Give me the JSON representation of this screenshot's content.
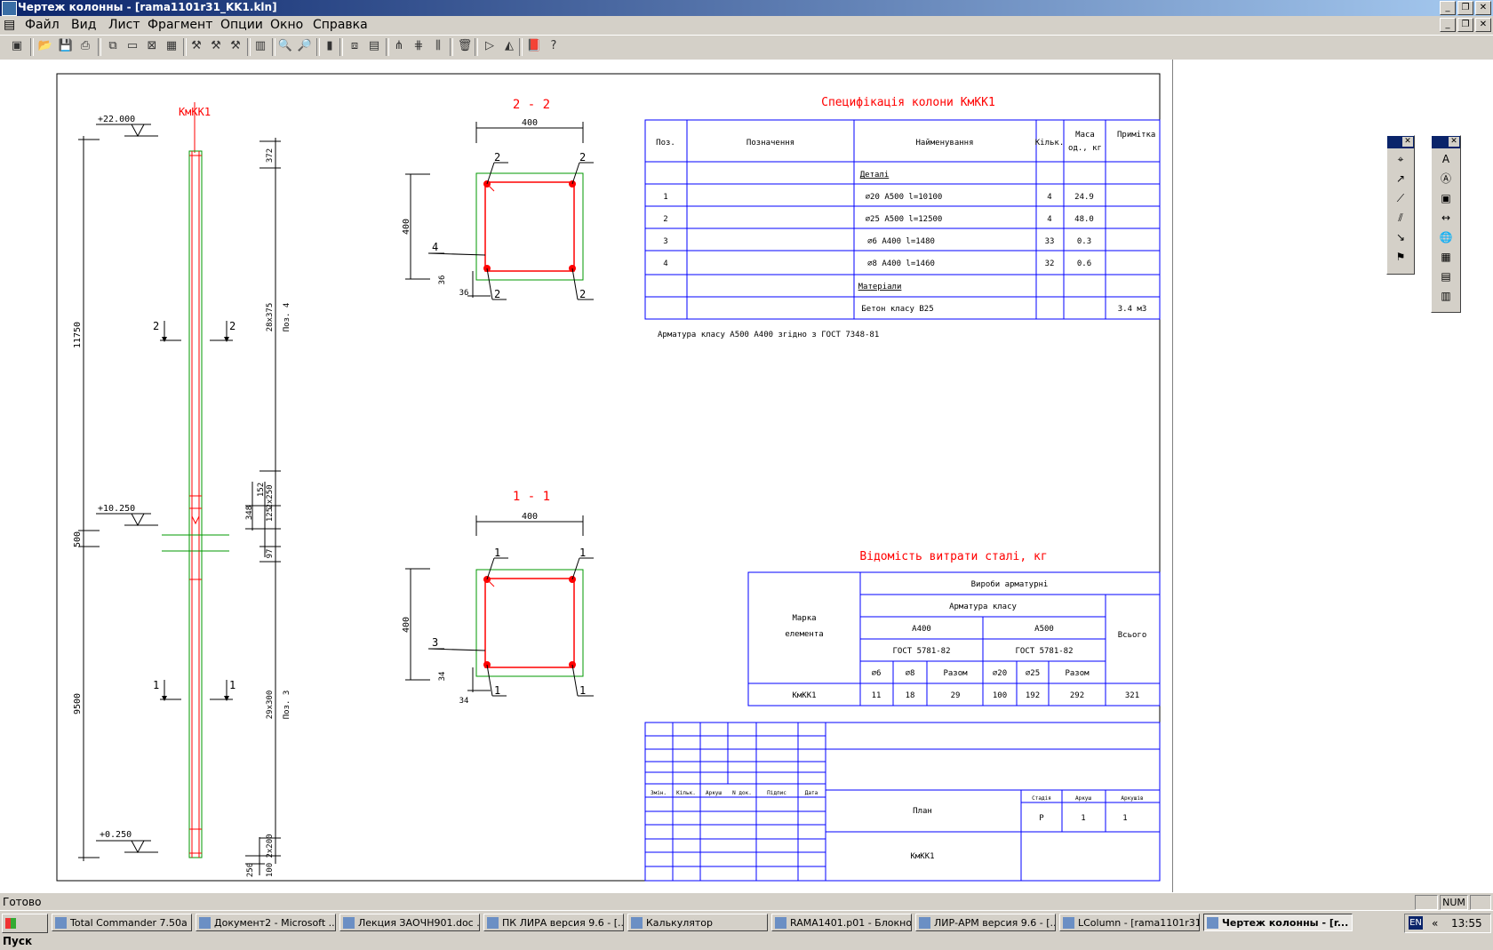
{
  "window": {
    "title": "Чертеж колонны - [rama1101r31_KK1.kln]"
  },
  "menu": [
    "Файл",
    "Вид",
    "Лист",
    "Фрагмент",
    "Опции",
    "Окно",
    "Справка"
  ],
  "drawing": {
    "column_label": "КмКК1",
    "elevations": [
      "+22.000",
      "+10.250",
      "+0.250"
    ],
    "left_dims": [
      "11750",
      "500",
      "9500"
    ],
    "right_dims": [
      "372",
      "28x375",
      "Поз. 4",
      "152",
      "348",
      "2x250",
      "125",
      "97",
      "29x300",
      "Поз. 3",
      "2x200",
      "100",
      "250"
    ],
    "section_marks": [
      "2",
      "2",
      "1",
      "1"
    ],
    "section22": {
      "title": "2 - 2",
      "width": "400",
      "height": "400",
      "cover_v": "36",
      "cover_h": "36",
      "bar_marks": [
        "2",
        "2",
        "2",
        "2"
      ],
      "stirrup": "4"
    },
    "section11": {
      "title": "1 - 1",
      "width": "400",
      "height": "400",
      "cover_v": "34",
      "cover_h": "34",
      "bar_marks": [
        "1",
        "1",
        "1",
        "1"
      ],
      "stirrup": "3"
    },
    "spec": {
      "title": "Специфікація колони КмКК1",
      "headers": [
        "Поз.",
        "Позначення",
        "Найменування",
        "Кільк.",
        "Маса од., кг",
        "Примітка"
      ],
      "section_details": "Деталі",
      "rows": [
        {
          "pos": "1",
          "name": "∅20 A500 l=10100",
          "qty": "4",
          "mass": "24.9",
          "note": ""
        },
        {
          "pos": "2",
          "name": "∅25 A500 l=12500",
          "qty": "4",
          "mass": "48.0",
          "note": ""
        },
        {
          "pos": "3",
          "name": "∅6 A400 l=1480",
          "qty": "33",
          "mass": "0.3",
          "note": ""
        },
        {
          "pos": "4",
          "name": "∅8 A400 l=1460",
          "qty": "32",
          "mass": "0.6",
          "note": ""
        }
      ],
      "section_materials": "Матеріали",
      "concrete": {
        "name": "Бетон класу В25",
        "note": "3.4 м3"
      },
      "footnote": "Арматура класу А500 А400 згідно з ГОСТ 7348-81"
    },
    "steel": {
      "title": "Відомість витрати сталі, кг",
      "h_products": "Вироби арматурні",
      "h_class": "Арматура класу",
      "h_mark": "Марка елемента",
      "h_total": "Всього",
      "classes": [
        "A400",
        "A500"
      ],
      "gost": [
        "ГОСТ 5781-82",
        "ГОСТ 5781-82"
      ],
      "subcols": [
        "∅6",
        "∅8",
        "Разом",
        "∅20",
        "∅25",
        "Разом"
      ],
      "row": {
        "mark": "КмКК1",
        "values": [
          "11",
          "18",
          "29",
          "100",
          "192",
          "292"
        ],
        "total": "321"
      }
    },
    "stamp": {
      "cols": [
        "Змін.",
        "Кільк.",
        "Аркуш",
        "N док.",
        "Підпис",
        "Дата"
      ],
      "title": "План",
      "mark": "КмКК1",
      "stage_h": "Стадія",
      "sheet_h": "Аркуш",
      "sheets_h": "Аркушів",
      "stage": "Р",
      "sheet": "1",
      "sheets": "1"
    }
  },
  "status": {
    "text": "Готово",
    "num": "NUM"
  },
  "taskbar": {
    "start": "Пуск",
    "items": [
      "Total Commander 7.50a ...",
      "Документ2 - Microsoft ...",
      "Лекция ЗАОЧН901.doc ...",
      "ПК ЛИРА версия 9.6 - [...",
      "Калькулятор",
      "RAMA1401.p01 - Блокнот",
      "ЛИР-АРМ версия 9.6 - [...",
      "LColumn - [rama1101r31...",
      "Чертеж колонны - [r..."
    ],
    "lang": "EN",
    "clock": "13:55"
  },
  "colors": {
    "frame": "#000000",
    "table": "#0000ff",
    "accent": "#ff0000",
    "section": "#00a000"
  }
}
